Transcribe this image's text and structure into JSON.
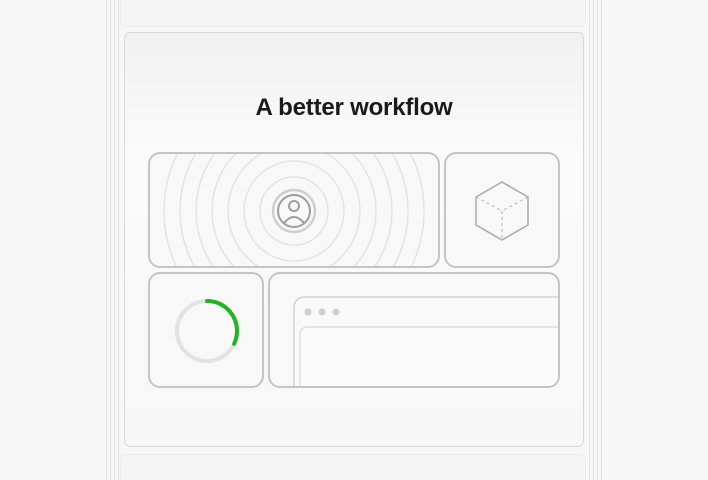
{
  "headline": "A better workflow",
  "progress": {
    "fraction": 0.32,
    "track_color": "#e2e2e2",
    "fill_color": "#22b322"
  },
  "icons": {
    "tile_top_left": "user-avatar-icon",
    "tile_top_right": "cube-icon",
    "tile_bottom_right": "browser-window-icon"
  },
  "colors": {
    "tile_border": "#c4c4c4",
    "headline": "#1a1a1a",
    "progress_accent": "#22b322"
  }
}
